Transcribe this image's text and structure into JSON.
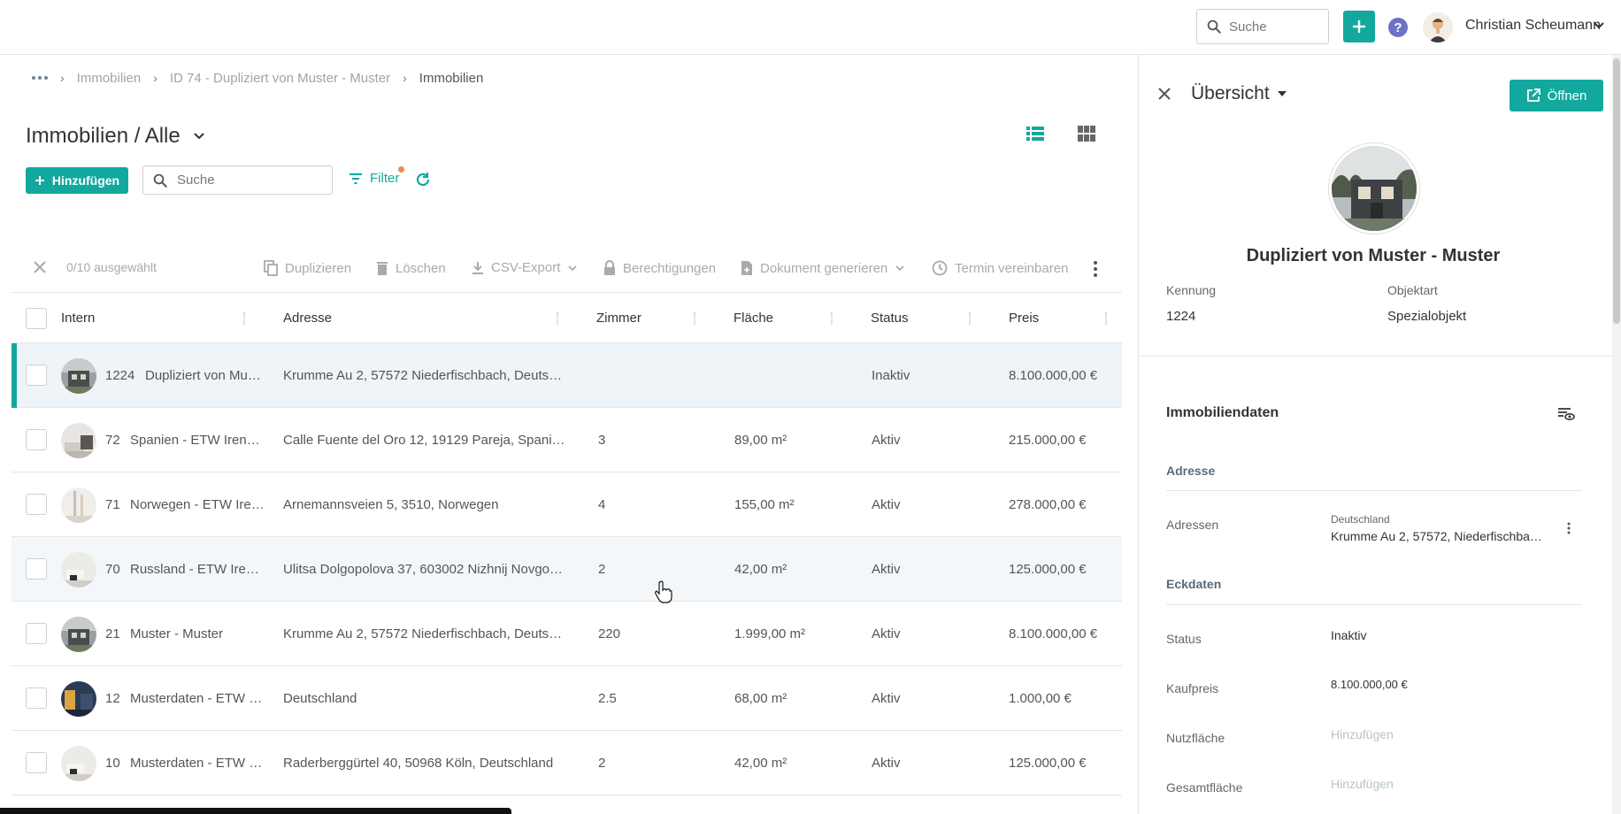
{
  "header": {
    "search_placeholder": "Suche",
    "user_name": "Christian Scheumann"
  },
  "breadcrumb": {
    "items": [
      "Immobilien",
      "ID 74 - Dupliziert von Muster - Muster",
      "Immobilien"
    ]
  },
  "page": {
    "title": "Immobilien / Alle",
    "add_label": "Hinzufügen",
    "search_placeholder": "Suche",
    "filter_label": "Filter"
  },
  "toolbar": {
    "selected": "0/10 ausgewählt",
    "duplicate": "Duplizieren",
    "delete": "Löschen",
    "csv_export": "CSV-Export",
    "permissions": "Berechtigungen",
    "generate_doc": "Dokument generieren",
    "schedule": "Termin vereinbaren"
  },
  "table": {
    "columns": [
      "Intern",
      "Adresse",
      "Zimmer",
      "Fläche",
      "Status",
      "Preis"
    ],
    "rows": [
      {
        "id": "1224",
        "name": "Dupliziert von Mus…",
        "address": "Krumme Au 2, 57572 Niederfischbach, Deutschla…",
        "rooms": "",
        "area": "",
        "status": "Inaktiv",
        "price": "8.100.000,00 €"
      },
      {
        "id": "72",
        "name": "Spanien - ETW Irene…",
        "address": "Calle Fuente del Oro 12, 19129 Pareja, Spanien",
        "rooms": "3",
        "area": "89,00 m²",
        "status": "Aktiv",
        "price": "215.000,00 €"
      },
      {
        "id": "71",
        "name": "Norwegen - ETW Ire…",
        "address": "Arnemannsveien 5, 3510, Norwegen",
        "rooms": "4",
        "area": "155,00 m²",
        "status": "Aktiv",
        "price": "278.000,00 €"
      },
      {
        "id": "70",
        "name": "Russland - ETW Iren…",
        "address": "Ulitsa Dolgopolova 37, 603002 Nizhnij Novgorod",
        "rooms": "2",
        "area": "42,00 m²",
        "status": "Aktiv",
        "price": "125.000,00 €"
      },
      {
        "id": "21",
        "name": "Muster - Muster",
        "address": "Krumme Au 2, 57572 Niederfischbach, Deutschla…",
        "rooms": "220",
        "area": "1.999,00 m²",
        "status": "Aktiv",
        "price": "8.100.000,00 €"
      },
      {
        "id": "12",
        "name": "Musterdaten - ETW E…",
        "address": "Deutschland",
        "rooms": "2.5",
        "area": "68,00 m²",
        "status": "Aktiv",
        "price": "1.000,00 €"
      },
      {
        "id": "10",
        "name": "Musterdaten - ETW I…",
        "address": "Raderberggürtel 40, 50968 Köln, Deutschland",
        "rooms": "2",
        "area": "42,00 m²",
        "status": "Aktiv",
        "price": "125.000,00 €"
      }
    ]
  },
  "panel": {
    "title": "Übersicht",
    "open_label": "Öffnen",
    "name": "Dupliziert von Muster - Muster",
    "kennung_label": "Kennung",
    "kennung_value": "1224",
    "objektart_label": "Objektart",
    "objektart_value": "Spezialobjekt",
    "section_title": "Immobiliendaten",
    "address_group": "Adresse",
    "addresses_label": "Adressen",
    "address_country": "Deutschland",
    "address_value": "Krumme Au 2, 57572, Niederfischba…",
    "eckdaten_group": "Eckdaten",
    "status_label": "Status",
    "status_value": "Inaktiv",
    "kaufpreis_label": "Kaufpreis",
    "kaufpreis_value": "8.100.000,00 €",
    "nutzflaeche_label": "Nutzfläche",
    "nutzflaeche_value": "Hinzufügen",
    "gesamtflaeche_label": "Gesamtfläche",
    "gesamtflaeche_value": "Hinzufügen"
  },
  "colors": {
    "accent": "#13a89e",
    "filter_dot": "#ef8a4b",
    "help": "#6c72c8"
  }
}
